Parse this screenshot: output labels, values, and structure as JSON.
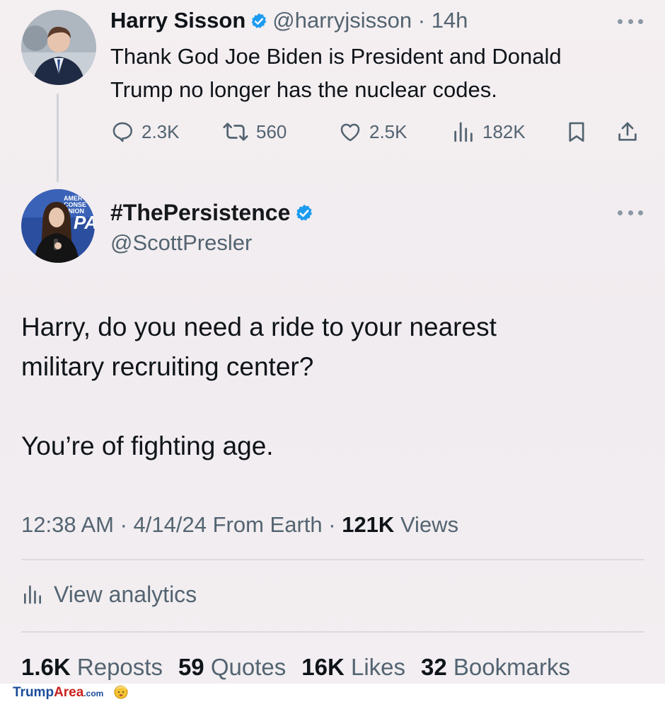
{
  "reply_tweet": {
    "author_name": "Harry Sisson",
    "handle": "@harryjsisson",
    "separator": " · ",
    "time": "14h",
    "text_line1": "Thank God Joe Biden is President and Donald",
    "text_line2": "Trump no longer has the nuclear codes.",
    "replies": "2.3K",
    "reposts": "560",
    "likes": "2.5K",
    "views": "182K",
    "icons": [
      "reply-icon",
      "repost-icon",
      "like-icon",
      "views-icon",
      "bookmark-icon",
      "share-icon",
      "more-icon",
      "verified-icon"
    ]
  },
  "main_tweet": {
    "author_name": "#ThePersistence",
    "handle": "@ScottPresler",
    "avatar_sign_text": [
      "AMER",
      "CONSE",
      "UNION"
    ],
    "avatar_logo_text": "PA",
    "text_line1": "Harry, do you need a ride to your nearest",
    "text_line2": "military recruiting center?",
    "text_line3": "You’re of fighting age.",
    "time": "12:38 AM",
    "date": "4/14/24",
    "source": "From Earth",
    "views_count": "121K",
    "views_label": "Views",
    "analytics_label": "View analytics",
    "reposts_count": "1.6K",
    "reposts_label": "Reposts",
    "quotes_count": "59",
    "quotes_label": "Quotes",
    "likes_count": "16K",
    "likes_label": "Likes",
    "bookmarks_count": "32",
    "bookmarks_label": "Bookmarks"
  },
  "watermark": {
    "part1": "Trump",
    "part2": "Area",
    "part3": ".com"
  },
  "colors": {
    "verified": "#1d9bf0",
    "secondary_text": "#536471",
    "primary_text": "#0f1419",
    "background": "#f2eef1"
  }
}
